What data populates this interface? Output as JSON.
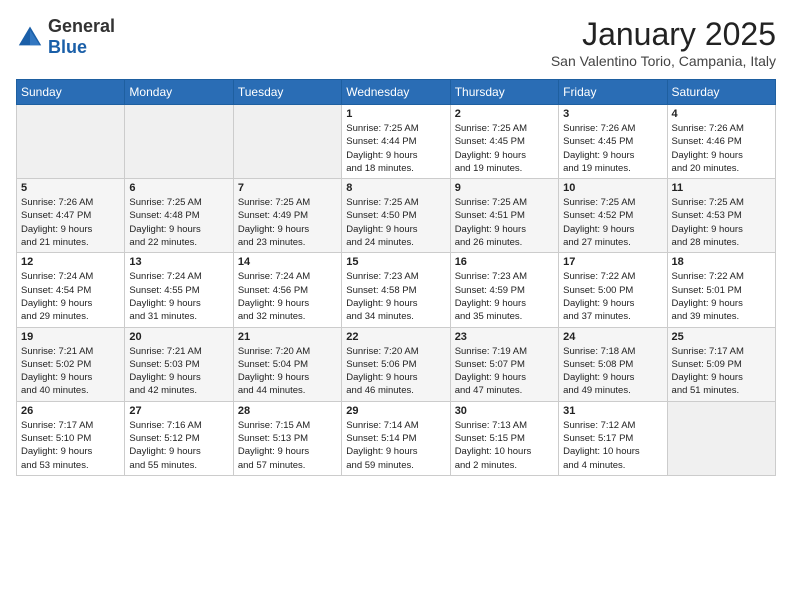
{
  "header": {
    "logo_general": "General",
    "logo_blue": "Blue",
    "month_year": "January 2025",
    "location": "San Valentino Torio, Campania, Italy"
  },
  "days_of_week": [
    "Sunday",
    "Monday",
    "Tuesday",
    "Wednesday",
    "Thursday",
    "Friday",
    "Saturday"
  ],
  "weeks": [
    [
      {
        "day": "",
        "info": ""
      },
      {
        "day": "",
        "info": ""
      },
      {
        "day": "",
        "info": ""
      },
      {
        "day": "1",
        "info": "Sunrise: 7:25 AM\nSunset: 4:44 PM\nDaylight: 9 hours\nand 18 minutes."
      },
      {
        "day": "2",
        "info": "Sunrise: 7:25 AM\nSunset: 4:45 PM\nDaylight: 9 hours\nand 19 minutes."
      },
      {
        "day": "3",
        "info": "Sunrise: 7:26 AM\nSunset: 4:45 PM\nDaylight: 9 hours\nand 19 minutes."
      },
      {
        "day": "4",
        "info": "Sunrise: 7:26 AM\nSunset: 4:46 PM\nDaylight: 9 hours\nand 20 minutes."
      }
    ],
    [
      {
        "day": "5",
        "info": "Sunrise: 7:26 AM\nSunset: 4:47 PM\nDaylight: 9 hours\nand 21 minutes."
      },
      {
        "day": "6",
        "info": "Sunrise: 7:25 AM\nSunset: 4:48 PM\nDaylight: 9 hours\nand 22 minutes."
      },
      {
        "day": "7",
        "info": "Sunrise: 7:25 AM\nSunset: 4:49 PM\nDaylight: 9 hours\nand 23 minutes."
      },
      {
        "day": "8",
        "info": "Sunrise: 7:25 AM\nSunset: 4:50 PM\nDaylight: 9 hours\nand 24 minutes."
      },
      {
        "day": "9",
        "info": "Sunrise: 7:25 AM\nSunset: 4:51 PM\nDaylight: 9 hours\nand 26 minutes."
      },
      {
        "day": "10",
        "info": "Sunrise: 7:25 AM\nSunset: 4:52 PM\nDaylight: 9 hours\nand 27 minutes."
      },
      {
        "day": "11",
        "info": "Sunrise: 7:25 AM\nSunset: 4:53 PM\nDaylight: 9 hours\nand 28 minutes."
      }
    ],
    [
      {
        "day": "12",
        "info": "Sunrise: 7:24 AM\nSunset: 4:54 PM\nDaylight: 9 hours\nand 29 minutes."
      },
      {
        "day": "13",
        "info": "Sunrise: 7:24 AM\nSunset: 4:55 PM\nDaylight: 9 hours\nand 31 minutes."
      },
      {
        "day": "14",
        "info": "Sunrise: 7:24 AM\nSunset: 4:56 PM\nDaylight: 9 hours\nand 32 minutes."
      },
      {
        "day": "15",
        "info": "Sunrise: 7:23 AM\nSunset: 4:58 PM\nDaylight: 9 hours\nand 34 minutes."
      },
      {
        "day": "16",
        "info": "Sunrise: 7:23 AM\nSunset: 4:59 PM\nDaylight: 9 hours\nand 35 minutes."
      },
      {
        "day": "17",
        "info": "Sunrise: 7:22 AM\nSunset: 5:00 PM\nDaylight: 9 hours\nand 37 minutes."
      },
      {
        "day": "18",
        "info": "Sunrise: 7:22 AM\nSunset: 5:01 PM\nDaylight: 9 hours\nand 39 minutes."
      }
    ],
    [
      {
        "day": "19",
        "info": "Sunrise: 7:21 AM\nSunset: 5:02 PM\nDaylight: 9 hours\nand 40 minutes."
      },
      {
        "day": "20",
        "info": "Sunrise: 7:21 AM\nSunset: 5:03 PM\nDaylight: 9 hours\nand 42 minutes."
      },
      {
        "day": "21",
        "info": "Sunrise: 7:20 AM\nSunset: 5:04 PM\nDaylight: 9 hours\nand 44 minutes."
      },
      {
        "day": "22",
        "info": "Sunrise: 7:20 AM\nSunset: 5:06 PM\nDaylight: 9 hours\nand 46 minutes."
      },
      {
        "day": "23",
        "info": "Sunrise: 7:19 AM\nSunset: 5:07 PM\nDaylight: 9 hours\nand 47 minutes."
      },
      {
        "day": "24",
        "info": "Sunrise: 7:18 AM\nSunset: 5:08 PM\nDaylight: 9 hours\nand 49 minutes."
      },
      {
        "day": "25",
        "info": "Sunrise: 7:17 AM\nSunset: 5:09 PM\nDaylight: 9 hours\nand 51 minutes."
      }
    ],
    [
      {
        "day": "26",
        "info": "Sunrise: 7:17 AM\nSunset: 5:10 PM\nDaylight: 9 hours\nand 53 minutes."
      },
      {
        "day": "27",
        "info": "Sunrise: 7:16 AM\nSunset: 5:12 PM\nDaylight: 9 hours\nand 55 minutes."
      },
      {
        "day": "28",
        "info": "Sunrise: 7:15 AM\nSunset: 5:13 PM\nDaylight: 9 hours\nand 57 minutes."
      },
      {
        "day": "29",
        "info": "Sunrise: 7:14 AM\nSunset: 5:14 PM\nDaylight: 9 hours\nand 59 minutes."
      },
      {
        "day": "30",
        "info": "Sunrise: 7:13 AM\nSunset: 5:15 PM\nDaylight: 10 hours\nand 2 minutes."
      },
      {
        "day": "31",
        "info": "Sunrise: 7:12 AM\nSunset: 5:17 PM\nDaylight: 10 hours\nand 4 minutes."
      },
      {
        "day": "",
        "info": ""
      }
    ]
  ]
}
